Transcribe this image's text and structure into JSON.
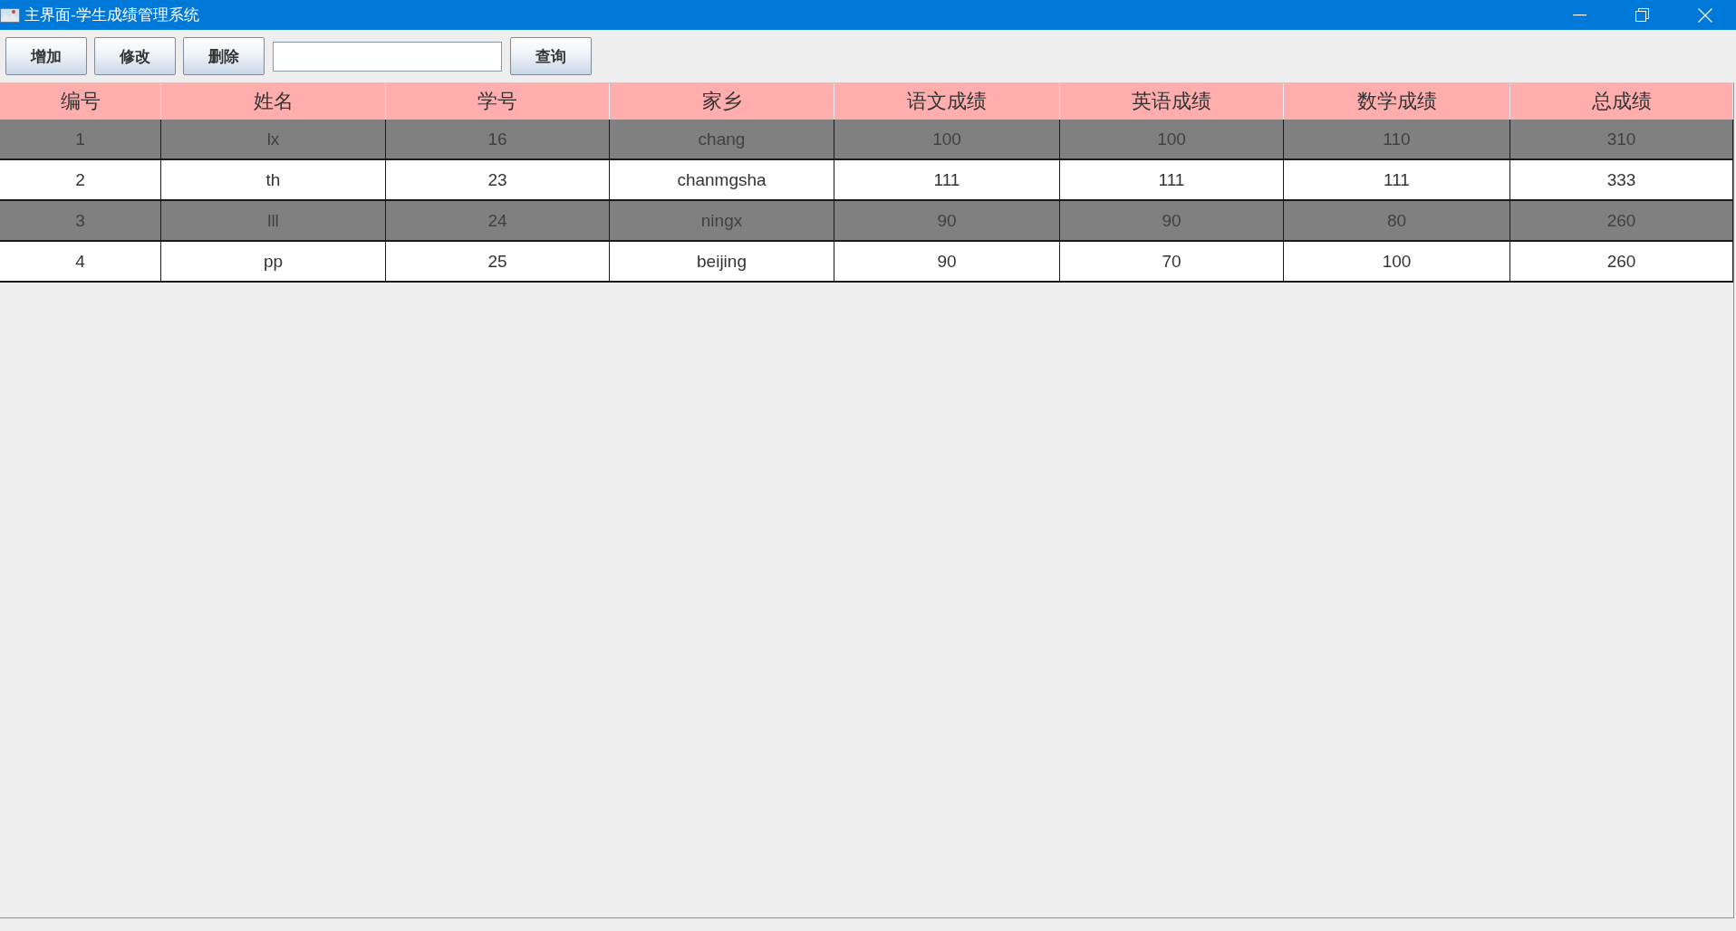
{
  "window": {
    "title": "主界面-学生成绩管理系统"
  },
  "toolbar": {
    "buttons": [
      "增加",
      "修改",
      "删除"
    ],
    "search_button": "查询"
  },
  "table": {
    "columns": [
      "编号",
      "姓名",
      "学号",
      "家乡",
      "语文成绩",
      "英语成绩",
      "数学成绩",
      "总成绩"
    ],
    "rows": [
      [
        "1",
        "lx",
        "16",
        "chang",
        "100",
        "100",
        "110",
        "310"
      ],
      [
        "2",
        "th",
        "23",
        "chanmgsha",
        "111",
        "111",
        "111",
        "333"
      ],
      [
        "3",
        "lll",
        "24",
        "ningx",
        "90",
        "90",
        "80",
        "260"
      ],
      [
        "4",
        "pp",
        "25",
        "beijing",
        "90",
        "70",
        "100",
        "260"
      ]
    ]
  }
}
